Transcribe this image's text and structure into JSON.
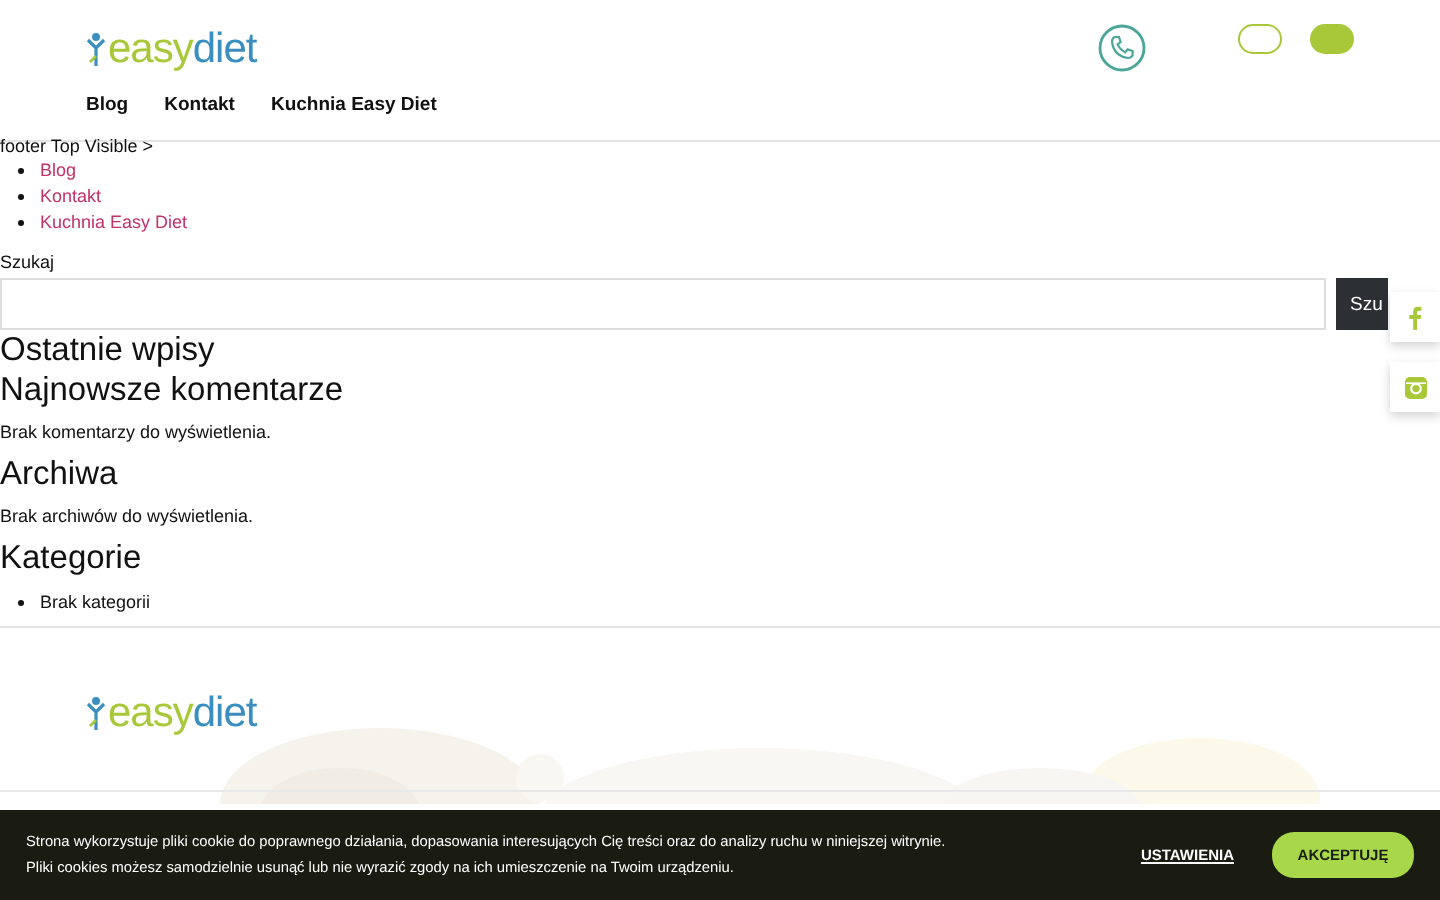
{
  "header": {
    "logo": {
      "part_1": "easy",
      "part_2": "diet"
    },
    "nav": [
      "Blog",
      "Kontakt",
      "Kuchnia Easy Diet"
    ]
  },
  "content": {
    "breadcrumb": "footer Top Visible >",
    "links": [
      "Blog",
      "Kontakt",
      "Kuchnia Easy Diet"
    ],
    "search": {
      "label": "Szukaj",
      "button": "Szu"
    },
    "sections": [
      {
        "kind": "heading",
        "text": "Ostatnie wpisy"
      },
      {
        "kind": "heading",
        "text": "Najnowsze komentarze"
      },
      {
        "kind": "text",
        "text": "Brak komentarzy do wyświetlenia."
      },
      {
        "kind": "heading",
        "text": "Archiwa"
      },
      {
        "kind": "text",
        "text": "Brak archiwów do wyświetlenia."
      },
      {
        "kind": "heading",
        "text": "Kategorie"
      },
      {
        "kind": "bullet",
        "text": "Brak kategorii"
      }
    ]
  },
  "footer": {
    "logo": {
      "part_1": "easy",
      "part_2": "diet"
    }
  },
  "cookie_bar": {
    "lines": [
      "Strona wykorzystuje pliki cookie do poprawnego działania, dopasowania interesujących Cię treści oraz do analizy ruchu w niniejszej witrynie.",
      "Pliki cookies możesz samodzielnie usunąć lub nie wyrazić zgody na ich umieszczenie na Twoim urządzeniu."
    ],
    "settings": "USTAWIENIA",
    "accept": "AKCEPTUJĘ"
  }
}
